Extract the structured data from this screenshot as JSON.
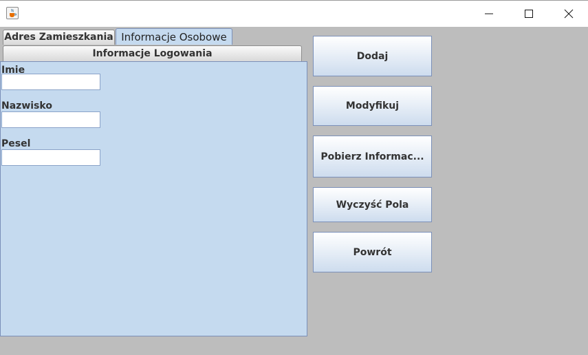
{
  "window": {
    "icon": "java-cup-icon",
    "controls": [
      "minimize-icon",
      "maximize-icon",
      "close-icon"
    ]
  },
  "tabs": {
    "row1": [
      "Adres Zamieszkania",
      "Informacje Osobowe"
    ],
    "row2": [
      "Informacje Logowania"
    ],
    "selected": "Informacje Osobowe"
  },
  "form": {
    "imie_label": "Imie",
    "imie_value": "",
    "nazwisko_label": "Nazwisko",
    "nazwisko_value": "",
    "pesel_label": "Pesel",
    "pesel_value": ""
  },
  "buttons": {
    "dodaj": "Dodaj",
    "modyfikuj": "Modyfikuj",
    "pobierz": "Pobierz Informac...",
    "wyczysc": "Wyczyść Pola",
    "powrot": "Powrót"
  },
  "colors": {
    "panel_bg": "#c5daef",
    "window_bg": "#bdbdbd",
    "border_accent": "#7a8fb8"
  }
}
